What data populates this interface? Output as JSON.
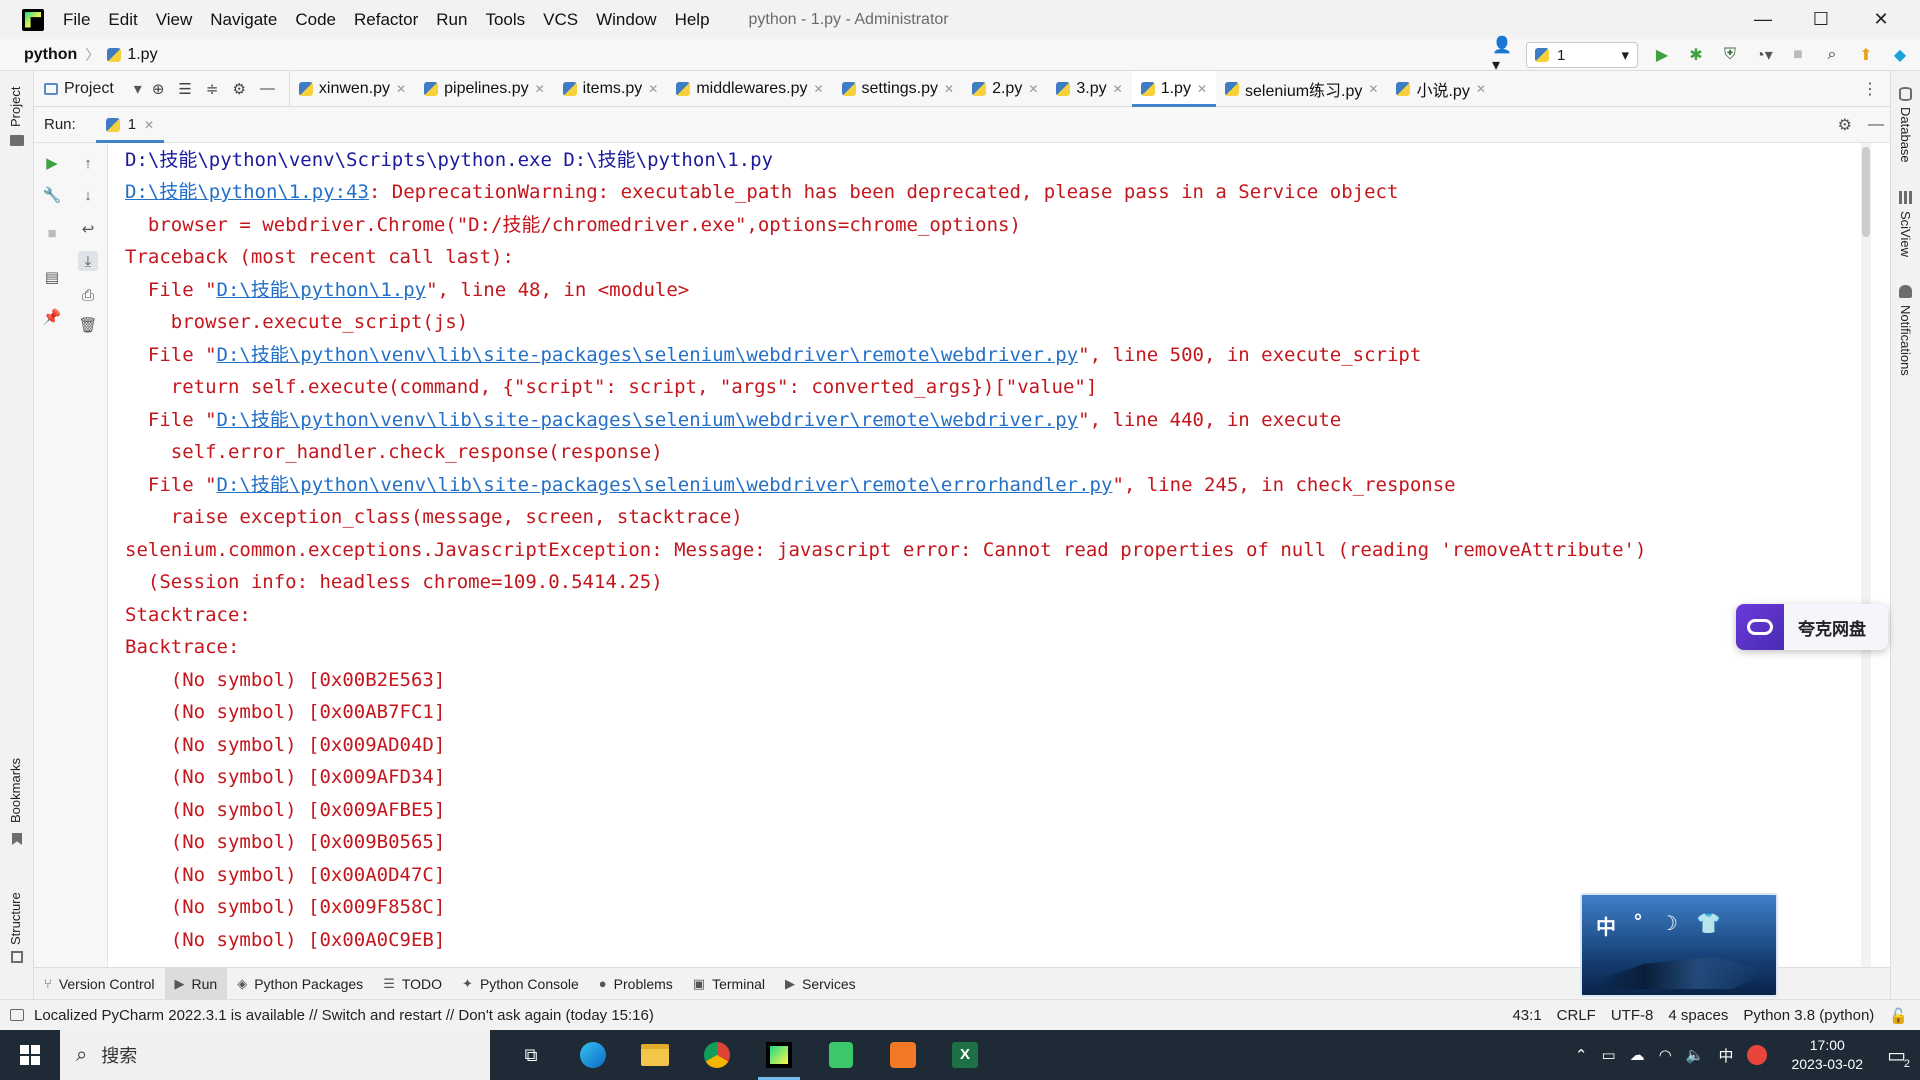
{
  "titlebar": {
    "menu": [
      "File",
      "Edit",
      "View",
      "Navigate",
      "Code",
      "Refactor",
      "Run",
      "Tools",
      "VCS",
      "Window",
      "Help"
    ],
    "window_title": "python - 1.py - Administrator",
    "minimize": "—",
    "maximize": "☐",
    "close": "✕"
  },
  "navbar": {
    "project": "python",
    "file": "1.py",
    "run_config": "1"
  },
  "left_strip": {
    "project": "Project",
    "bookmarks": "Bookmarks",
    "structure": "Structure"
  },
  "right_strip": {
    "database": "Database",
    "sciview": "SciView",
    "notifications": "Notifications"
  },
  "project_panel": {
    "label": "Project"
  },
  "tabs": [
    {
      "label": "xinwen.py"
    },
    {
      "label": "pipelines.py"
    },
    {
      "label": "items.py"
    },
    {
      "label": "middlewares.py"
    },
    {
      "label": "settings.py"
    },
    {
      "label": "2.py"
    },
    {
      "label": "3.py"
    },
    {
      "label": "1.py",
      "active": true
    },
    {
      "label": "selenium练习.py"
    },
    {
      "label": "小说.py"
    }
  ],
  "run": {
    "label": "Run:",
    "tab": "1"
  },
  "console": {
    "l1": "D:\\技能\\python\\venv\\Scripts\\python.exe D:\\技能\\python\\1.py",
    "l2_link": "D:\\技能\\python\\1.py:43",
    "l2_rest": ": DeprecationWarning: executable_path has been deprecated, please pass in a Service object",
    "l3": "  browser = webdriver.Chrome(\"D:/技能/chromedriver.exe\",options=chrome_options)",
    "l4": "Traceback (most recent call last):",
    "l5_pre": "  File \"",
    "l5_link": "D:\\技能\\python\\1.py",
    "l5_post": "\", line 48, in <module>",
    "l6": "    browser.execute_script(js)",
    "l7_pre": "  File \"",
    "l7_link": "D:\\技能\\python\\venv\\lib\\site-packages\\selenium\\webdriver\\remote\\webdriver.py",
    "l7_post": "\", line 500, in execute_script",
    "l8": "    return self.execute(command, {\"script\": script, \"args\": converted_args})[\"value\"]",
    "l9_pre": "  File \"",
    "l9_link": "D:\\技能\\python\\venv\\lib\\site-packages\\selenium\\webdriver\\remote\\webdriver.py",
    "l9_post": "\", line 440, in execute",
    "l10": "    self.error_handler.check_response(response)",
    "l11_pre": "  File \"",
    "l11_link": "D:\\技能\\python\\venv\\lib\\site-packages\\selenium\\webdriver\\remote\\errorhandler.py",
    "l11_post": "\", line 245, in check_response",
    "l12": "    raise exception_class(message, screen, stacktrace)",
    "l13": "selenium.common.exceptions.JavascriptException: Message: javascript error: Cannot read properties of null (reading 'removeAttribute')",
    "l14": "  (Session info: headless chrome=109.0.5414.25)",
    "l15": "Stacktrace:",
    "l16": "Backtrace:",
    "bt": [
      "    (No symbol) [0x00B2E563]",
      "    (No symbol) [0x00AB7FC1]",
      "    (No symbol) [0x009AD04D]",
      "    (No symbol) [0x009AFD34]",
      "    (No symbol) [0x009AFBE5]",
      "    (No symbol) [0x009B0565]",
      "    (No symbol) [0x00A0D47C]",
      "    (No symbol) [0x009F858C]",
      "    (No symbol) [0x00A0C9EB]"
    ]
  },
  "bottom_tabs": [
    {
      "label": "Version Control"
    },
    {
      "label": "Run",
      "active": true
    },
    {
      "label": "Python Packages"
    },
    {
      "label": "TODO"
    },
    {
      "label": "Python Console"
    },
    {
      "label": "Problems"
    },
    {
      "label": "Terminal"
    },
    {
      "label": "Services"
    }
  ],
  "status": {
    "message": "Localized PyCharm 2022.3.1 is available // Switch and restart // Don't ask again (today 15:16)",
    "position": "43:1",
    "line_sep": "CRLF",
    "encoding": "UTF-8",
    "indent": "4 spaces",
    "interpreter": "Python 3.8 (python)"
  },
  "taskbar": {
    "search": "搜索",
    "ime": "中",
    "time": "17:00",
    "date": "2023-03-02",
    "notif_count": "2"
  },
  "overlays": {
    "netdisk": "夸克网盘",
    "widget_chars": [
      "中",
      "°"
    ]
  },
  "colors": {
    "accent": "#4083c9",
    "error_text": "#c4161c",
    "link": "#2470c7",
    "command_text": "#1a1a9c"
  }
}
